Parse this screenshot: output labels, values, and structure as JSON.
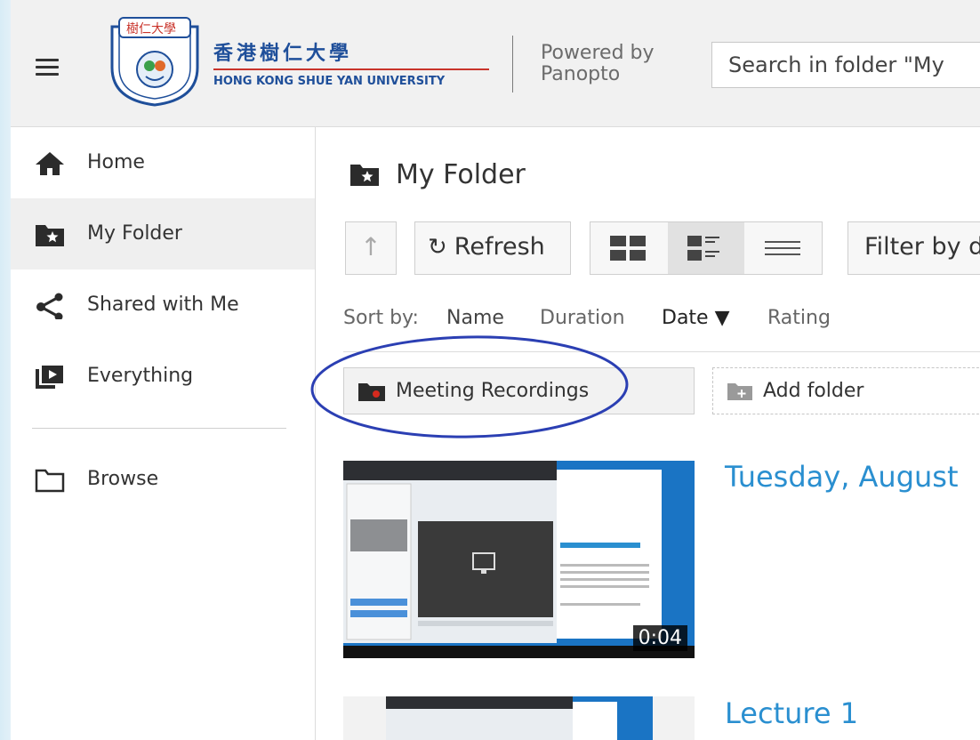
{
  "header": {
    "logo_cn_top": "樹仁大學",
    "logo_cn": "香港樹仁大學",
    "logo_en": "HONG KONG SHUE YAN UNIVERSITY",
    "powered_line1": "Powered by",
    "powered_line2": "Panopto",
    "search_placeholder": "Search in folder \"My"
  },
  "sidebar": {
    "items": [
      {
        "label": "Home",
        "icon": "home-icon"
      },
      {
        "label": "My Folder",
        "icon": "star-folder-icon",
        "active": true
      },
      {
        "label": "Shared with Me",
        "icon": "share-icon"
      },
      {
        "label": "Everything",
        "icon": "play-library-icon"
      },
      {
        "label": "Browse",
        "icon": "folder-outline-icon"
      }
    ]
  },
  "main": {
    "title": "My Folder",
    "toolbar": {
      "up_label": "↑",
      "refresh_label": "Refresh",
      "refresh_icon": "↻",
      "filter_label": "Filter by d"
    },
    "sort": {
      "prefix": "Sort by:",
      "options": [
        "Name",
        "Duration",
        "Date ▼",
        "Rating"
      ],
      "active": "Date"
    },
    "folders": [
      {
        "label": "Meeting Recordings"
      }
    ],
    "add_folder_label": "Add folder",
    "sessions": [
      {
        "title": "Tuesday, August",
        "duration": "0:04"
      },
      {
        "title": "Lecture 1"
      }
    ]
  },
  "colors": {
    "accent_link": "#2a8fd0",
    "annotation_ellipse": "#2b3fb3",
    "folder_dot": "#d62a1e"
  }
}
